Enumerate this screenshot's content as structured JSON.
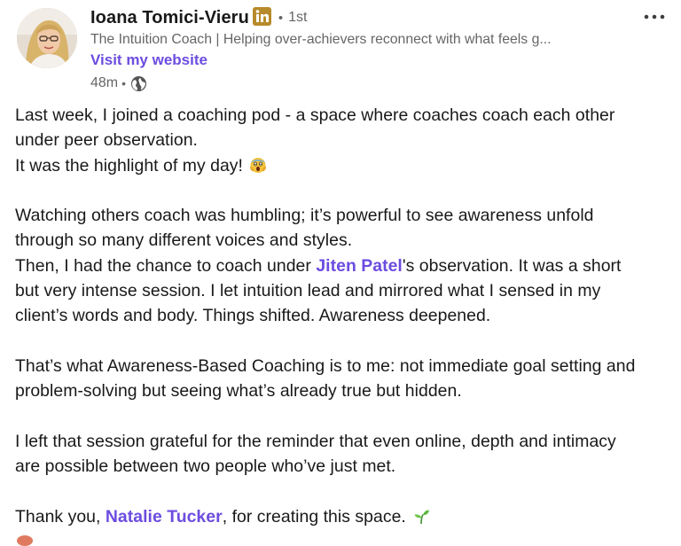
{
  "author": {
    "name": "Ioana Tomici-Vieru",
    "degree": "1st",
    "bullet": "•",
    "headline": "The Intuition Coach | Helping over-achievers reconnect with what feels g...",
    "website_label": "Visit my website",
    "time_ago": "48m",
    "time_separator": "•",
    "visibility_icon": "globe-icon",
    "badge_icon": "linkedin-icon"
  },
  "menu": {
    "icon": "more-horizontal-icon"
  },
  "colors": {
    "link": "#6c4ce0",
    "text": "#191919",
    "secondary": "#666666",
    "linkedin_blue": "#b78a2b"
  },
  "post": {
    "p1": {
      "l1": "Last week, I joined a coaching pod - a space where coaches coach each other",
      "l2": "under peer observation.",
      "l3": "It was the highlight of my day! "
    },
    "p2": {
      "l1": "Watching others coach was humbling; it’s powerful to see awareness unfold",
      "l2": "through so many different voices and styles.",
      "l3_before": "Then, I had the chance to coach under ",
      "l3_mention": "Jiten Patel",
      "l3_after": "'s observation. It was a short",
      "l4": "but very intense session. I let intuition lead and mirrored what I sensed in my",
      "l5": "client’s words and body. Things shifted. Awareness deepened."
    },
    "p3": {
      "l1": "That’s what Awareness-Based Coaching is to me: not immediate goal setting and",
      "l2": "problem-solving but seeing what’s already true but hidden."
    },
    "p4": {
      "l1": "I left that session grateful for the reminder that even online, depth and intimacy",
      "l2": "are possible between two people who’ve just met."
    },
    "p5": {
      "before": "Thank you, ",
      "mention": "Natalie Tucker",
      "after": ", for creating this space. "
    },
    "emojis": [
      "scream-emoji-icon",
      "seedling-emoji-icon"
    ]
  }
}
